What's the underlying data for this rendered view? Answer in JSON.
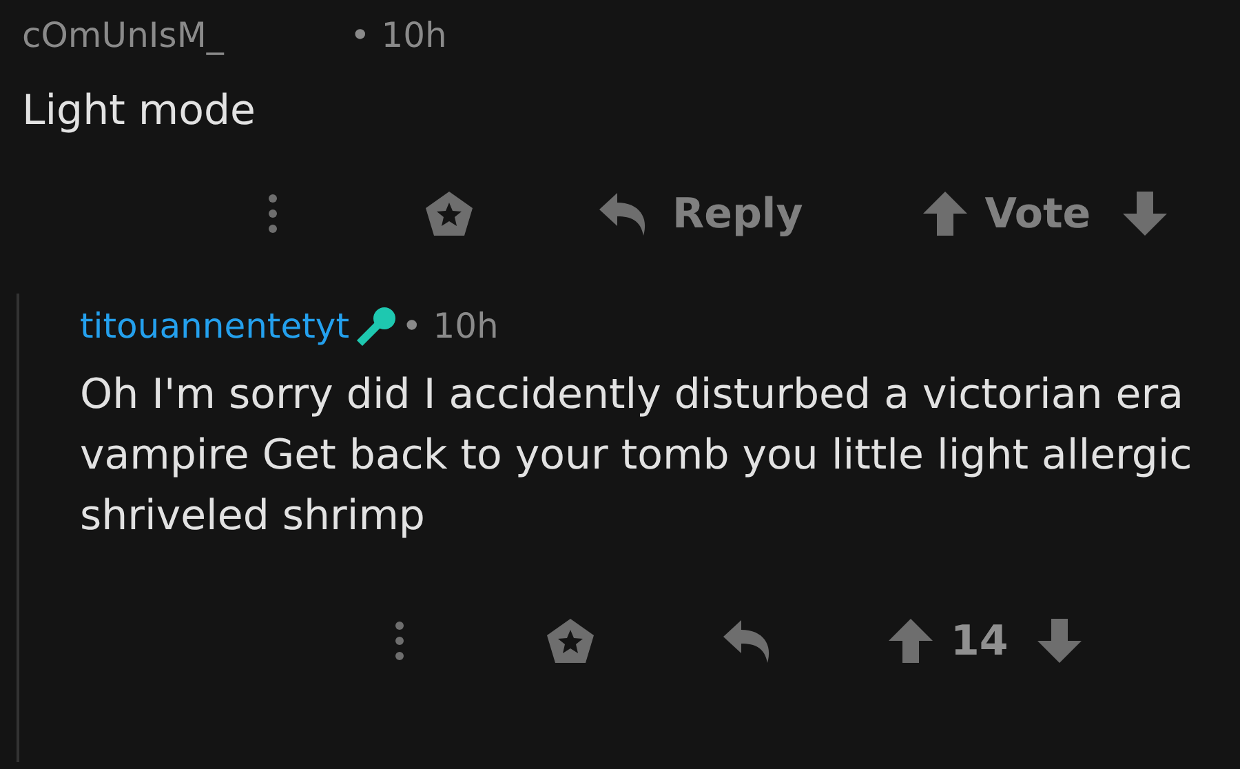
{
  "comment": {
    "author": "cOmUnIsM_",
    "age": "• 10h",
    "body": "Light mode",
    "actions": {
      "reply": "Reply",
      "vote": "Vote"
    }
  },
  "reply": {
    "author": "titouannentetyt",
    "flair": {
      "kind": "mic"
    },
    "age": "• 10h",
    "body": "Oh I'm sorry did I accidently disturbed a victorian era vampire Get back to your tomb you little light allergic shriveled shrimp",
    "score": "14"
  }
}
